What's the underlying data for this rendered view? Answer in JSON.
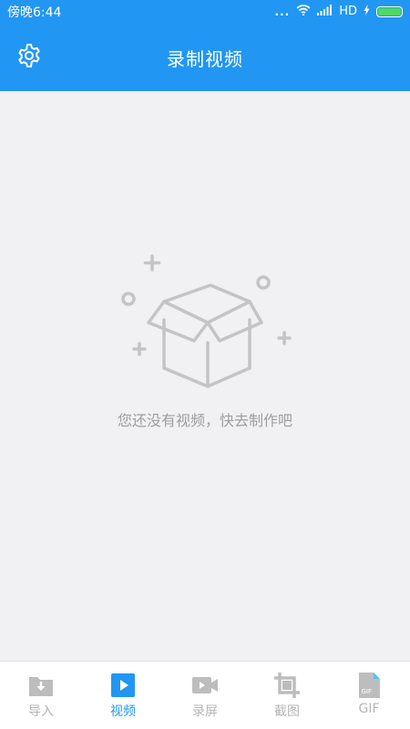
{
  "status_bar": {
    "time": "傍晚6:44",
    "dots": "...",
    "network": "HD"
  },
  "header": {
    "title": "录制视频",
    "settings_icon": "gear-icon"
  },
  "empty_state": {
    "message": "您还没有视频，快去制作吧",
    "illustration": "empty-box-icon"
  },
  "tabs": [
    {
      "label": "导入",
      "icon": "import-icon",
      "active": false
    },
    {
      "label": "视频",
      "icon": "video-play-icon",
      "active": true
    },
    {
      "label": "录屏",
      "icon": "screen-record-icon",
      "active": false
    },
    {
      "label": "截图",
      "icon": "crop-icon",
      "active": false
    },
    {
      "label": "GIF",
      "icon": "gif-file-icon",
      "active": false
    }
  ],
  "colors": {
    "primary": "#2196f3",
    "background": "#f1f0f3",
    "inactive": "#b5b5b5",
    "battery": "#4cd964"
  }
}
